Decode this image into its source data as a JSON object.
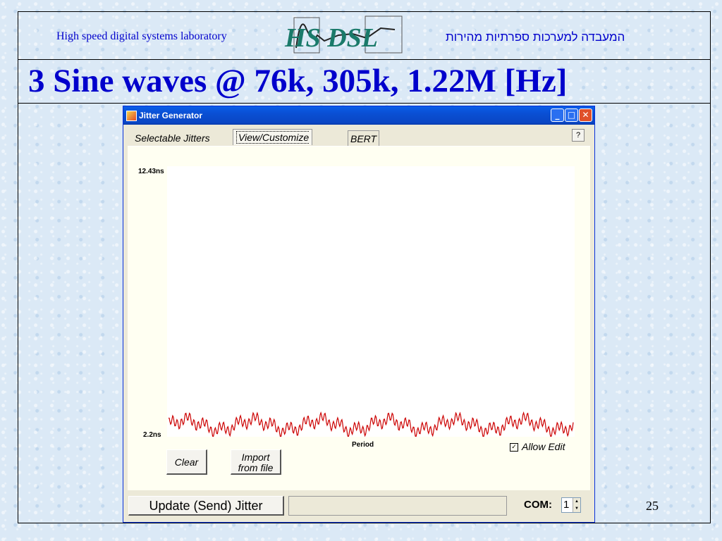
{
  "slide": {
    "lab_name_en": "High speed digital systems laboratory",
    "lab_name_he": "המעבדה למערכות ספרתיות מהירות",
    "logo_text": "HS DSL",
    "title": "3 Sine waves @ 76k, 305k, 1.22M [Hz]",
    "page_number": "25"
  },
  "window": {
    "title": "Jitter Generator",
    "minimize_glyph": "_",
    "maximize_glyph": "□",
    "close_glyph": "✕",
    "help_label": "?",
    "tabs": [
      "Selectable Jitters",
      "View/Customize Jitter",
      "BERT"
    ],
    "selected_tab": "View/Customize Jitter"
  },
  "chart_data": {
    "type": "line",
    "y_max_label": "12.43ns",
    "y_min_label": "2.2ns",
    "xlabel": "Period",
    "ylim": [
      2.2,
      12.43
    ],
    "series_color": "#cc0000",
    "components_hz": [
      76000,
      305000,
      1220000
    ],
    "description_values": {
      "center": 2.65,
      "amplitude": 0.5
    }
  },
  "controls": {
    "allow_edit_label": "Allow Edit",
    "allow_edit_checked": true,
    "clear_label": "Clear",
    "import_label_line1": "Import",
    "import_label_line2": "from file",
    "update_label": "Update (Send) Jitter",
    "com_label": "COM:",
    "com_value": "1"
  }
}
